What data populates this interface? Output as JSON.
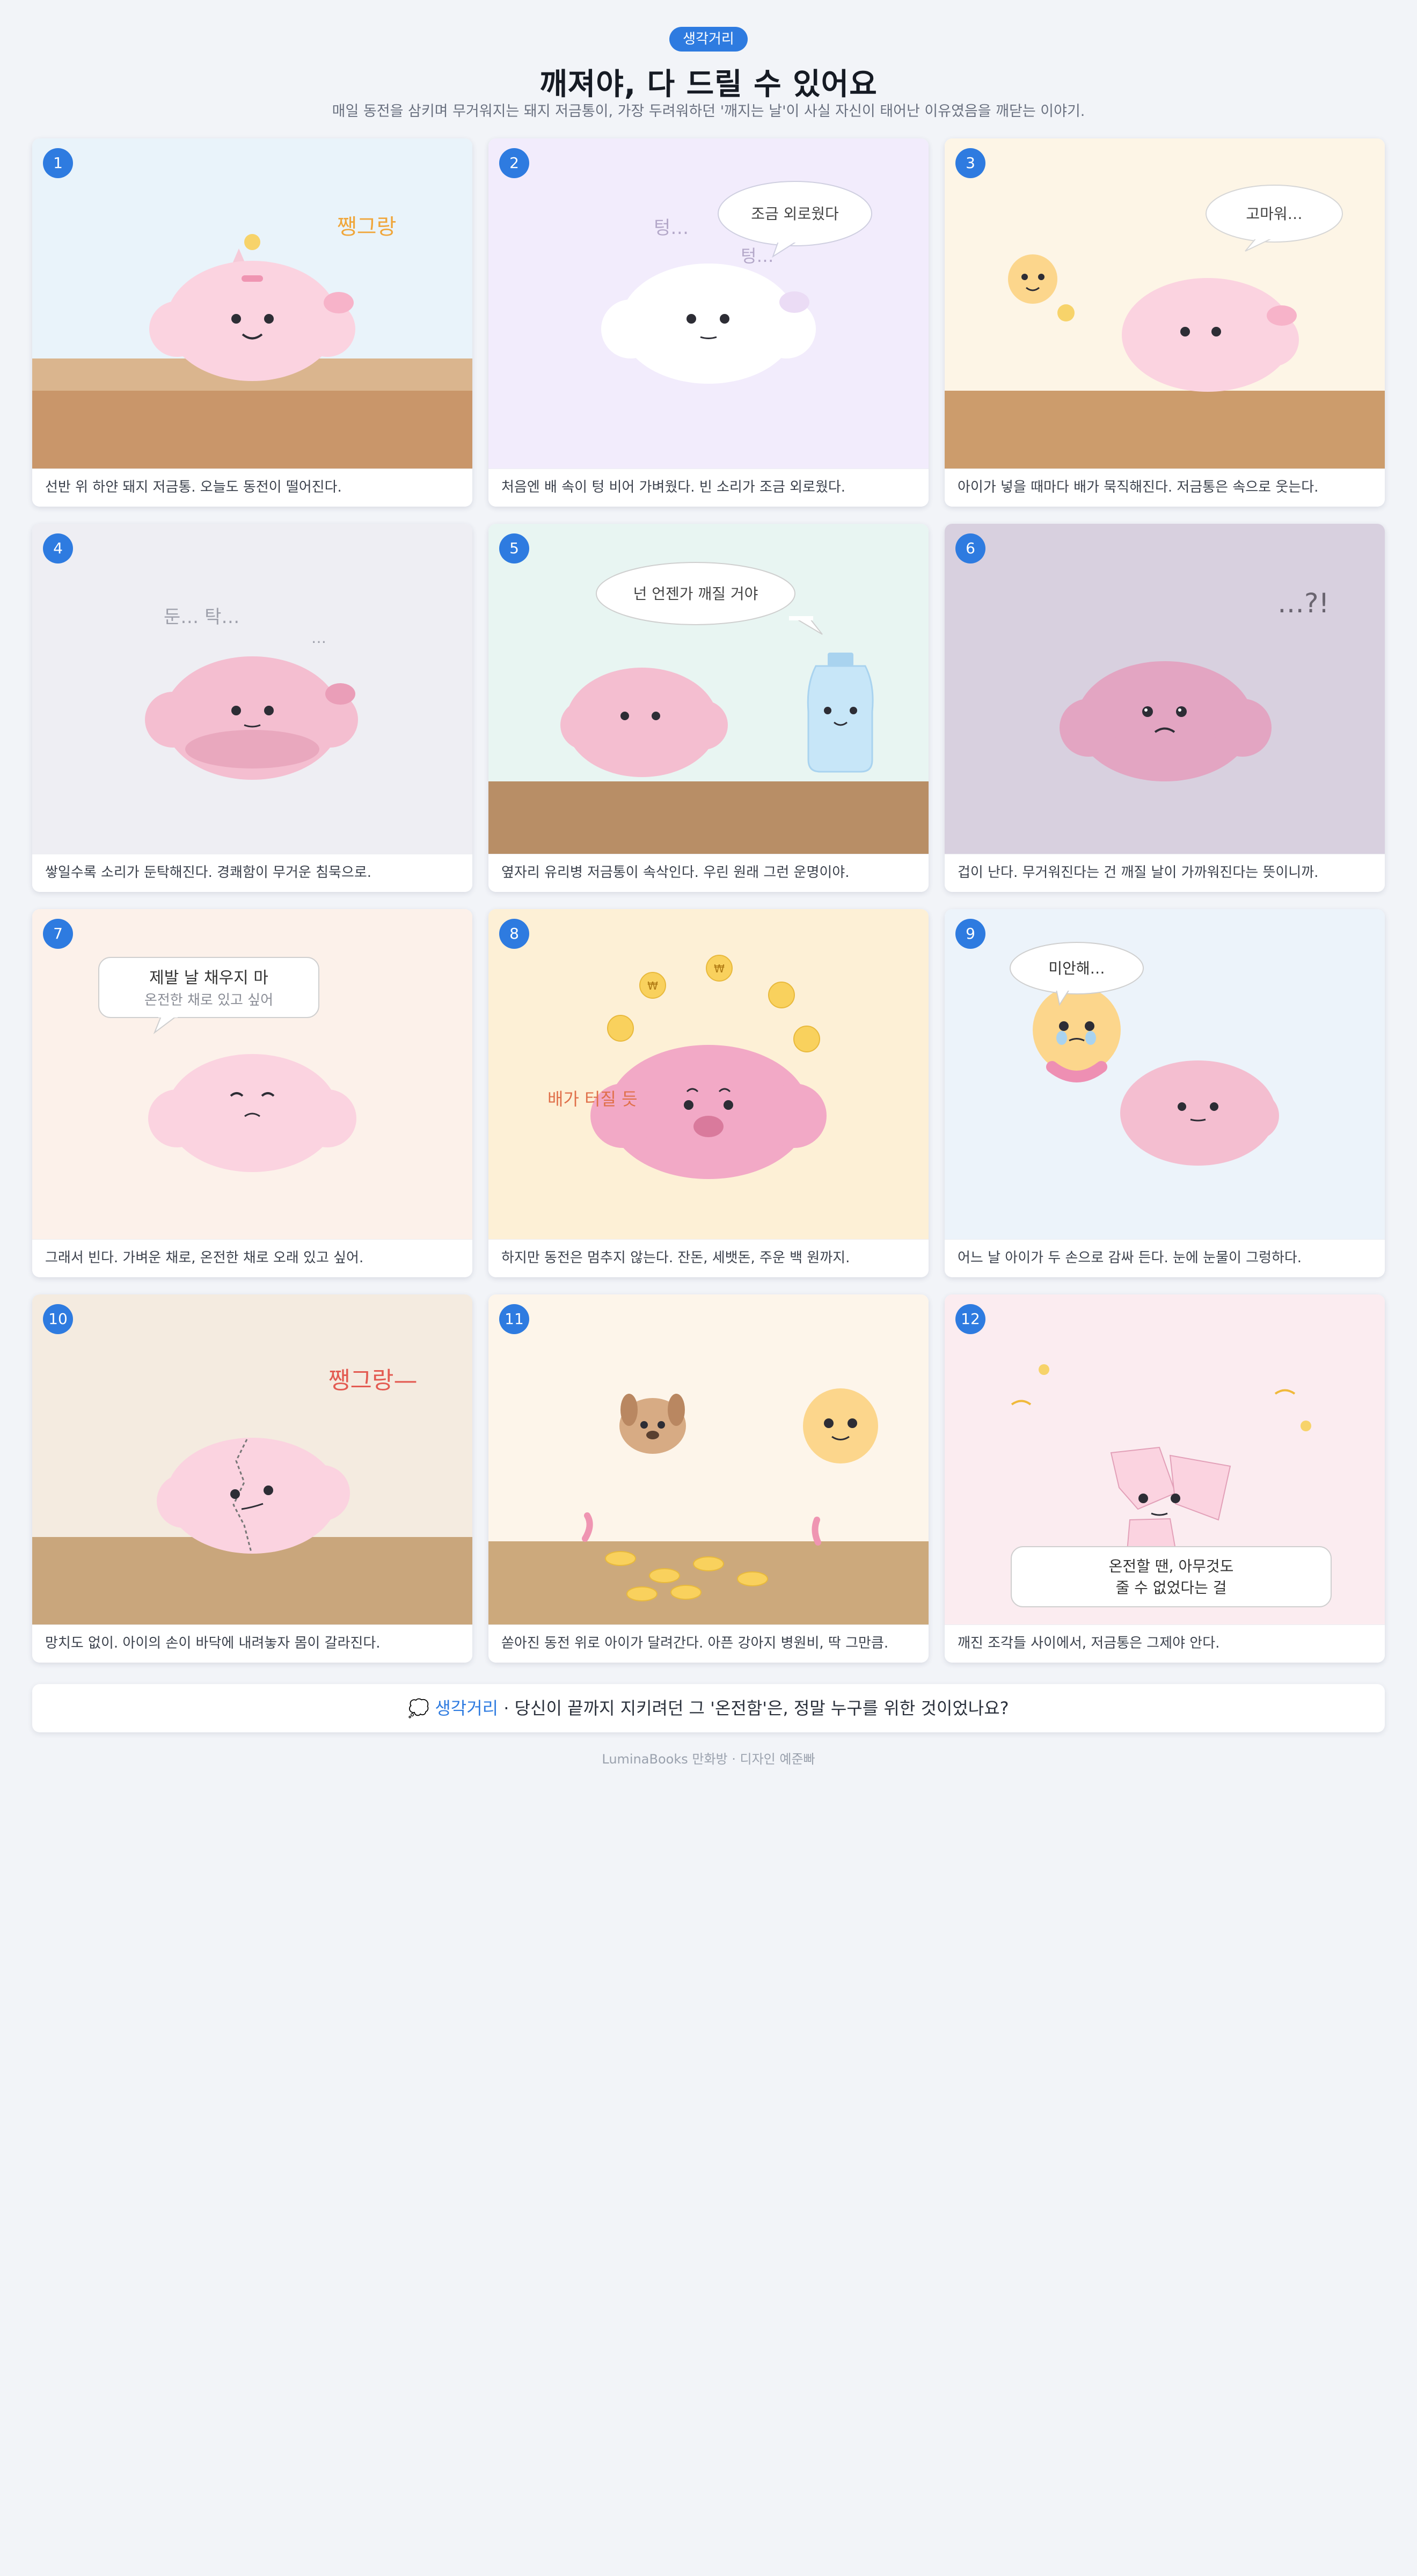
{
  "header": {
    "tag": "생각거리",
    "title": "깨져야, 다 드릴 수 있어요",
    "subtitle": "매일 동전을 삼키며 무거워지는 돼지 저금통이, 가장 두려워하던 '깨지는 날'이 사실 자신이 태어난 이유였음을 깨닫는 이야기."
  },
  "panels": [
    {
      "num": "1",
      "caption": "선반 위 하얀 돼지 저금통. 오늘도 동전이 떨어진다.",
      "sfx": "쨍그랑"
    },
    {
      "num": "2",
      "caption": "처음엔 배 속이 텅 비어 가벼웠다. 빈 소리가 조금 외로웠다.",
      "sfx1": "텅…",
      "sfx2": "텅…",
      "bubble": "조금 외로웠다"
    },
    {
      "num": "3",
      "caption": "아이가 넣을 때마다 배가 묵직해진다. 저금통은 속으로 웃는다.",
      "bubble": "고마워…"
    },
    {
      "num": "4",
      "caption": "쌓일수록 소리가 둔탁해진다. 경쾌함이 무거운 침묵으로.",
      "sfx1": "둔… 탁…",
      "sfx2": "…"
    },
    {
      "num": "5",
      "caption": "옆자리 유리병 저금통이 속삭인다. 우린 원래 그런 운명이야.",
      "bubble": "넌 언젠가 깨질 거야"
    },
    {
      "num": "6",
      "caption": "겁이 난다. 무거워진다는 건 깨질 날이 가까워진다는 뜻이니까.",
      "sfx": "…?!"
    },
    {
      "num": "7",
      "caption": "그래서 빈다. 가벼운 채로, 온전한 채로 오래 있고 싶어.",
      "bubble1": "제발 날 채우지 마",
      "bubble2": "온전한 채로 있고 싶어"
    },
    {
      "num": "8",
      "caption": "하지만 동전은 멈추지 않는다. 잔돈, 세뱃돈, 주운 백 원까지.",
      "sfx": "배가 터질 듯",
      "coin": "₩"
    },
    {
      "num": "9",
      "caption": "어느 날 아이가 두 손으로 감싸 든다. 눈에 눈물이 그렁하다.",
      "bubble": "미안해…"
    },
    {
      "num": "10",
      "caption": "망치도 없이. 아이의 손이 바닥에 내려놓자 몸이 갈라진다.",
      "sfx": "쨍그랑—"
    },
    {
      "num": "11",
      "caption": "쏟아진 동전 위로 아이가 달려간다. 아픈 강아지 병원비, 딱 그만큼."
    },
    {
      "num": "12",
      "caption": "깨진 조각들 사이에서, 저금통은 그제야 안다.",
      "bubble1": "온전할 땐, 아무것도",
      "bubble2": "줄 수 없었다는 걸"
    }
  ],
  "footer": {
    "icon": "💭",
    "accent": "생각거리",
    "text": " · 당신이 끝까지 지키려던 그 '온전함'은, 정말 누구를 위한 것이었나요?",
    "credit": "LuminaBooks 만화방 · 디자인 예준빠"
  }
}
